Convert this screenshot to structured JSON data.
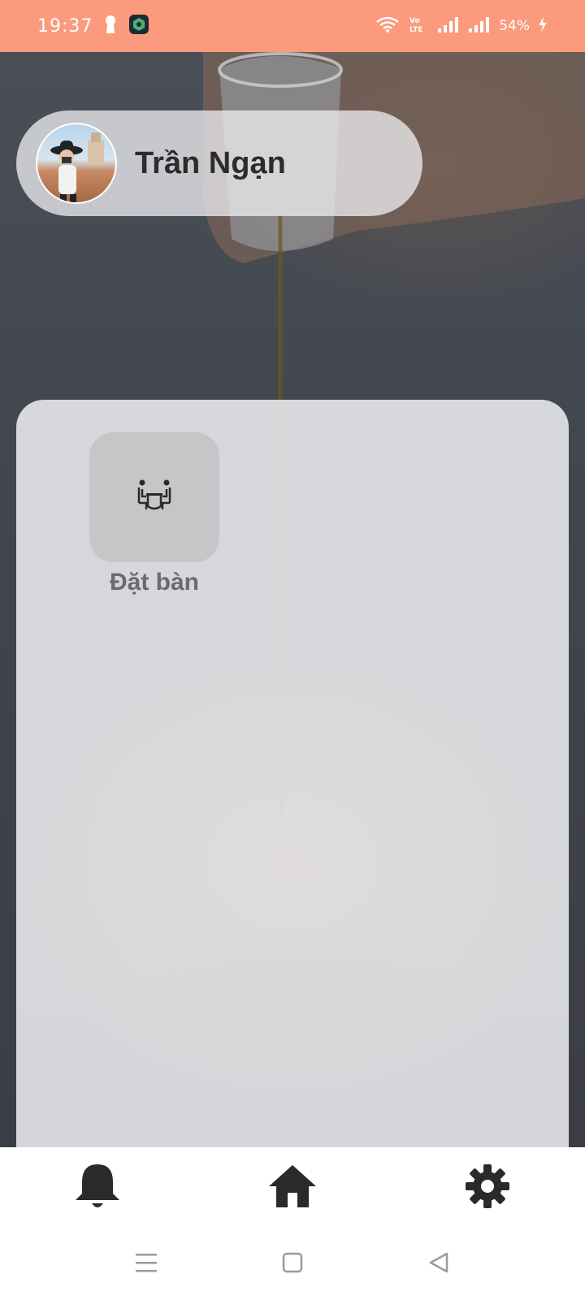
{
  "status_bar": {
    "time": "19:37",
    "battery": "54%",
    "color": "#fb9a7c"
  },
  "profile": {
    "name": "Trần Ngạn"
  },
  "panel": {
    "tiles": [
      {
        "label": "Đặt bàn",
        "icon": "restaurant-table-icon"
      }
    ]
  },
  "bottom_nav": {
    "items": [
      {
        "icon": "bell-icon"
      },
      {
        "icon": "home-icon"
      },
      {
        "icon": "gear-icon"
      }
    ]
  },
  "system_nav": {
    "items": [
      {
        "icon": "recent-apps-icon"
      },
      {
        "icon": "home-square-icon"
      },
      {
        "icon": "back-triangle-icon"
      }
    ]
  }
}
